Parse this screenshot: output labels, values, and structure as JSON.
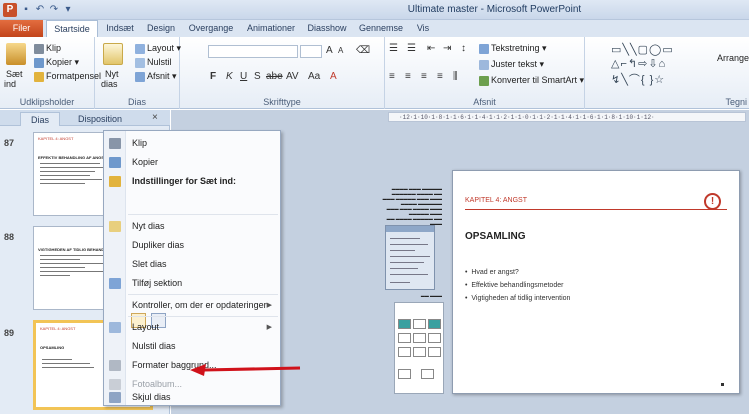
{
  "window": {
    "title": "Ultimate master - Microsoft PowerPoint",
    "app_icon": "P"
  },
  "quick_access": [
    "save-icon",
    "undo-icon",
    "redo-icon",
    "customize-icon"
  ],
  "ribbon_tabs": [
    {
      "label": "Filer"
    },
    {
      "label": "Startside"
    },
    {
      "label": "Indsæt"
    },
    {
      "label": "Design"
    },
    {
      "label": "Overgange"
    },
    {
      "label": "Animationer"
    },
    {
      "label": "Diasshow"
    },
    {
      "label": "Gennemse"
    },
    {
      "label": "Vis"
    }
  ],
  "ribbon": {
    "clipboard": {
      "paste": "Sæt",
      "paste2": "ind",
      "cut": "Klip",
      "copy": "Kopier",
      "format_painter": "Formatpensel",
      "label": "Udklipsholder"
    },
    "slides": {
      "new": "Nyt",
      "new2": "dias",
      "layout": "Layout",
      "reset": "Nulstil",
      "section": "Afsnit",
      "label": "Dias"
    },
    "font": {
      "label": "Skrifttype",
      "bold": "F",
      "italic": "K",
      "underline": "U",
      "strike": "S",
      "shadow": "abe",
      "spacing": "AV",
      "case": "Aa",
      "grow": "A",
      "shrink": "A"
    },
    "paragraph": {
      "text_direction": "Tekstretning",
      "align_text": "Juster tekst",
      "smartart": "Konverter til SmartArt",
      "label": "Afsnit"
    },
    "drawing": {
      "arrange": "Arranger",
      "label": "Tegni"
    }
  },
  "left_panel": {
    "tab_slides": "Dias",
    "tab_outline": "Disposition",
    "close": "×",
    "slides": [
      {
        "number": "87",
        "kap": "KAPITEL 4: ANGST",
        "title": "EFFEKTIV BEHANDLING AF ANGST"
      },
      {
        "number": "88",
        "kap": "",
        "title": "VIGTIGHEDEN AF TIDLIG BEHANDLING"
      },
      {
        "number": "89",
        "kap": "KAPITEL 4: ANGST",
        "title": "OPSAMLING"
      }
    ]
  },
  "context_menu": {
    "items": [
      {
        "label": "Klip",
        "icon": "scissors-icon"
      },
      {
        "label": "Kopier",
        "icon": "copy-icon"
      },
      {
        "label": "Indstillinger for Sæt ind:",
        "icon": "paste-icon"
      },
      {
        "label": "Nyt dias",
        "icon": "new-slide-icon"
      },
      {
        "label": "Dupliker dias",
        "icon": ""
      },
      {
        "label": "Slet dias",
        "icon": ""
      },
      {
        "label": "Tilføj sektion",
        "icon": "section-icon"
      },
      {
        "label": "Kontroller, om der er opdateringer",
        "icon": ""
      },
      {
        "label": "Layout",
        "icon": "layout-icon"
      },
      {
        "label": "Nulstil dias",
        "icon": ""
      },
      {
        "label": "Formater baggrund...",
        "icon": "format-background-icon"
      },
      {
        "label": "Fotoalbum...",
        "icon": "photo-album-icon"
      },
      {
        "label": "Skjul dias",
        "icon": "hide-slide-icon"
      }
    ]
  },
  "ruler": {
    "text": "·12·1·10·1·8·1·1·6·1·1·4·1·1·2·1·1·0·1·1·2·1·1·4·1·1·6·1·1·8·1·10·1·12·"
  },
  "slide": {
    "kap": "KAPITEL 4: ANGST",
    "title": "OPSAMLING",
    "bullets": [
      "Hvad er angst?",
      "Effektive behandlingsmetoder",
      "Vigtigheden  af tidlig intervention"
    ]
  },
  "colors": {
    "accent_red": "#c0392b",
    "file_tab": "#c8502a",
    "selection_border": "#f2c456"
  }
}
